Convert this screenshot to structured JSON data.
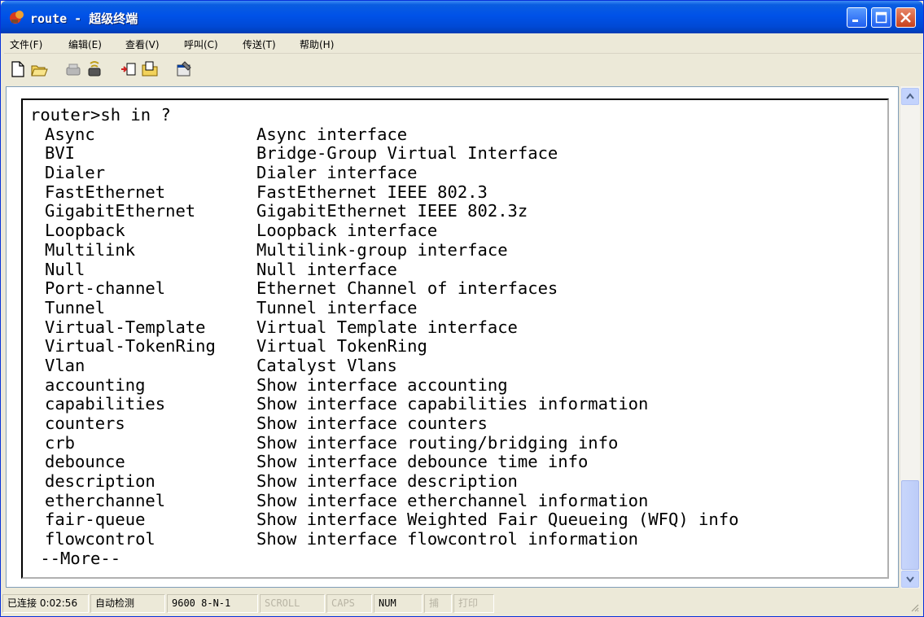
{
  "window": {
    "title": "route - 超级终端"
  },
  "menu": [
    {
      "label": "文件(F)"
    },
    {
      "label": "编辑(E)"
    },
    {
      "label": "查看(V)"
    },
    {
      "label": "呼叫(C)"
    },
    {
      "label": "传送(T)"
    },
    {
      "label": "帮助(H)"
    }
  ],
  "toolbar": {
    "icons": [
      "new-icon",
      "open-icon",
      "disconnect-icon",
      "connect-icon",
      "send-icon",
      "receive-icon",
      "properties-icon"
    ]
  },
  "terminal": {
    "prompt": "router>sh in ?",
    "rows": [
      {
        "cmd": "Async",
        "desc": "Async interface"
      },
      {
        "cmd": "BVI",
        "desc": "Bridge-Group Virtual Interface"
      },
      {
        "cmd": "Dialer",
        "desc": "Dialer interface"
      },
      {
        "cmd": "FastEthernet",
        "desc": "FastEthernet IEEE 802.3"
      },
      {
        "cmd": "GigabitEthernet",
        "desc": "GigabitEthernet IEEE 802.3z"
      },
      {
        "cmd": "Loopback",
        "desc": "Loopback interface"
      },
      {
        "cmd": "Multilink",
        "desc": "Multilink-group interface"
      },
      {
        "cmd": "Null",
        "desc": "Null interface"
      },
      {
        "cmd": "Port-channel",
        "desc": "Ethernet Channel of interfaces"
      },
      {
        "cmd": "Tunnel",
        "desc": "Tunnel interface"
      },
      {
        "cmd": "Virtual-Template",
        "desc": "Virtual Template interface"
      },
      {
        "cmd": "Virtual-TokenRing",
        "desc": "Virtual TokenRing"
      },
      {
        "cmd": "Vlan",
        "desc": "Catalyst Vlans"
      },
      {
        "cmd": "accounting",
        "desc": "Show interface accounting"
      },
      {
        "cmd": "capabilities",
        "desc": "Show interface capabilities information"
      },
      {
        "cmd": "counters",
        "desc": "Show interface counters"
      },
      {
        "cmd": "crb",
        "desc": "Show interface routing/bridging info"
      },
      {
        "cmd": "debounce",
        "desc": "Show interface debounce time info"
      },
      {
        "cmd": "description",
        "desc": "Show interface description"
      },
      {
        "cmd": "etherchannel",
        "desc": "Show interface etherchannel information"
      },
      {
        "cmd": "fair-queue",
        "desc": "Show interface Weighted Fair Queueing (WFQ) info"
      },
      {
        "cmd": "flowcontrol",
        "desc": "Show interface flowcontrol information"
      }
    ],
    "more": " --More--"
  },
  "statusbar": {
    "connection": "已连接 0:02:56",
    "detect": "自动检测",
    "settings": "9600 8-N-1",
    "scroll": "SCROLL",
    "caps": "CAPS",
    "num": "NUM",
    "capture": "捕",
    "print": "打印"
  }
}
